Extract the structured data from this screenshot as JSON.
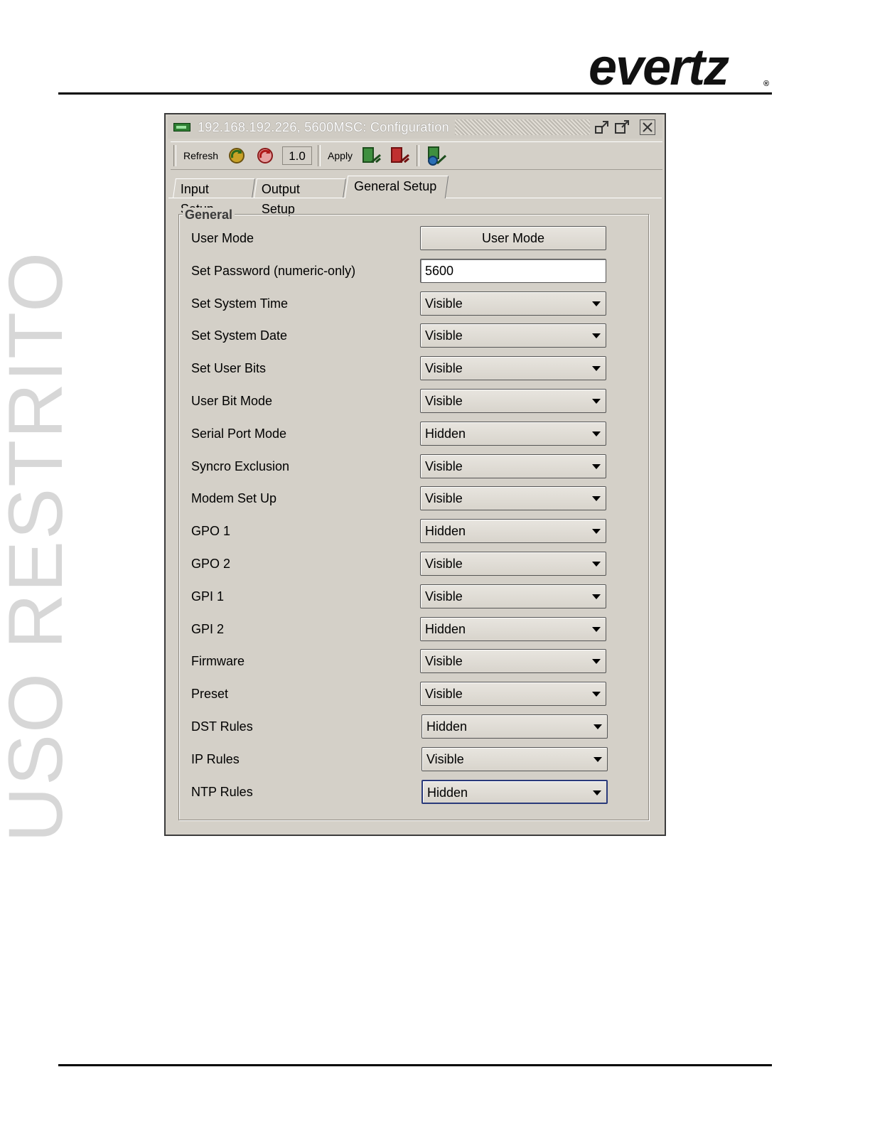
{
  "page": {
    "logo": "evertz",
    "watermark": "USO RESTRITO"
  },
  "window": {
    "title": "192.168.192.226, 5600MSC: Configuration"
  },
  "toolbar": {
    "refresh_label": "Refresh",
    "version_value": "1.0",
    "apply_label": "Apply",
    "icons": [
      "refresh-all-icon",
      "refresh-selected-icon",
      "apply-all-icon",
      "apply-selected-icon",
      "apply-global-icon"
    ]
  },
  "tabs": [
    {
      "label": "Input Setup",
      "active": false
    },
    {
      "label": "Output Setup",
      "active": false
    },
    {
      "label": "General Setup",
      "active": true
    }
  ],
  "group": {
    "title": "General",
    "rows": [
      {
        "label": "User Mode",
        "type": "button",
        "value": "User Mode"
      },
      {
        "label": "Set Password (numeric-only)",
        "type": "text",
        "value": "5600"
      },
      {
        "label": "Set System Time",
        "type": "select",
        "value": "Visible"
      },
      {
        "label": "Set System Date",
        "type": "select",
        "value": "Visible"
      },
      {
        "label": "Set User Bits",
        "type": "select",
        "value": "Visible"
      },
      {
        "label": "User Bit Mode",
        "type": "select",
        "value": "Visible"
      },
      {
        "label": "Serial Port Mode",
        "type": "select",
        "value": "Hidden"
      },
      {
        "label": "Syncro Exclusion",
        "type": "select",
        "value": "Visible"
      },
      {
        "label": "Modem Set Up",
        "type": "select",
        "value": "Visible"
      },
      {
        "label": "GPO 1",
        "type": "select",
        "value": "Hidden"
      },
      {
        "label": "GPO 2",
        "type": "select",
        "value": "Visible"
      },
      {
        "label": "GPI 1",
        "type": "select",
        "value": "Visible"
      },
      {
        "label": "GPI 2",
        "type": "select",
        "value": "Hidden"
      },
      {
        "label": "Firmware",
        "type": "select",
        "value": "Visible"
      },
      {
        "label": "Preset",
        "type": "select",
        "value": "Visible"
      },
      {
        "label": "DST Rules",
        "type": "select",
        "value": "Hidden"
      },
      {
        "label": "IP Rules",
        "type": "select",
        "value": "Visible"
      },
      {
        "label": "NTP Rules",
        "type": "select",
        "value": "Hidden",
        "focused": true
      }
    ]
  }
}
